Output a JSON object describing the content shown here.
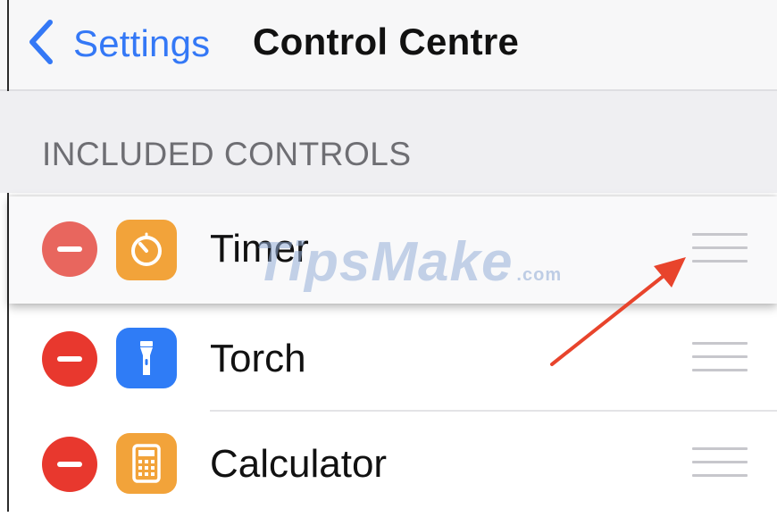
{
  "nav": {
    "back_label": "Settings",
    "title": "Control Centre"
  },
  "section": {
    "header": "INCLUDED CONTROLS"
  },
  "controls": [
    {
      "label": "Timer",
      "icon": "timer-icon",
      "icon_color": "#f2a33a"
    },
    {
      "label": "Torch",
      "icon": "torch-icon",
      "icon_color": "#2f7cf6"
    },
    {
      "label": "Calculator",
      "icon": "calculator-icon",
      "icon_color": "#f2a33a"
    }
  ],
  "colors": {
    "accent": "#3478f6",
    "remove": "#e8382e",
    "annotation_arrow": "#e8442c"
  },
  "watermark": {
    "text": "TipsMake",
    "suffix": ".com"
  }
}
